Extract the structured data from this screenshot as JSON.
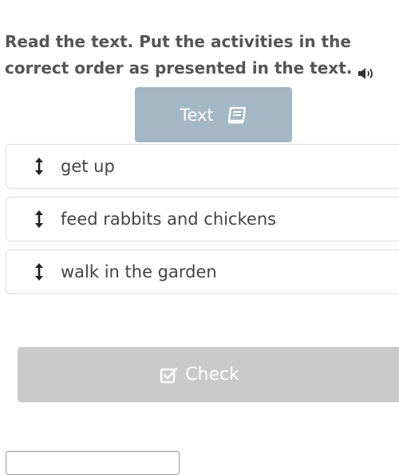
{
  "instruction": {
    "text": "Read the text. Put the activities in the correct order as presented in the text."
  },
  "text_button": {
    "label": "Text"
  },
  "items": [
    {
      "label": "get up"
    },
    {
      "label": "feed rabbits and chickens"
    },
    {
      "label": "walk in the garden"
    }
  ],
  "check_button": {
    "label": "Check"
  },
  "icons": {
    "speaker": "speaker-icon",
    "book": "book-icon",
    "drag": "vertical-arrows-icon",
    "check": "checkbox-icon"
  },
  "colors": {
    "text_button_bg": "#a3b7c4",
    "check_button_bg": "#c9c9c9",
    "instruction_text": "#555555",
    "item_text": "#444444"
  }
}
